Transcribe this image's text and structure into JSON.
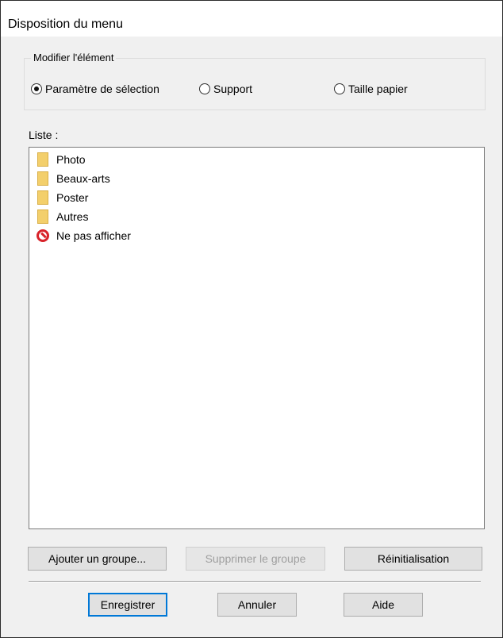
{
  "window": {
    "title": "Disposition du menu"
  },
  "modify_group": {
    "label": "Modifier l'élément",
    "options": [
      {
        "label": "Paramètre de sélection",
        "checked": true
      },
      {
        "label": "Support",
        "checked": false
      },
      {
        "label": "Taille papier",
        "checked": false
      }
    ]
  },
  "list": {
    "label": "Liste :",
    "items": [
      {
        "label": "Photo",
        "icon": "folder-icon"
      },
      {
        "label": "Beaux-arts",
        "icon": "folder-icon"
      },
      {
        "label": "Poster",
        "icon": "folder-icon"
      },
      {
        "label": "Autres",
        "icon": "folder-icon"
      },
      {
        "label": "Ne pas afficher",
        "icon": "no-display-icon"
      }
    ]
  },
  "buttons": {
    "add_group": "Ajouter un groupe...",
    "delete_group": "Supprimer le groupe",
    "reset": "Réinitialisation",
    "save": "Enregistrer",
    "cancel": "Annuler",
    "help": "Aide"
  },
  "colors": {
    "folder": "#f3cf6b",
    "no_display": "#d8232a",
    "default_button_border": "#0078d7"
  }
}
